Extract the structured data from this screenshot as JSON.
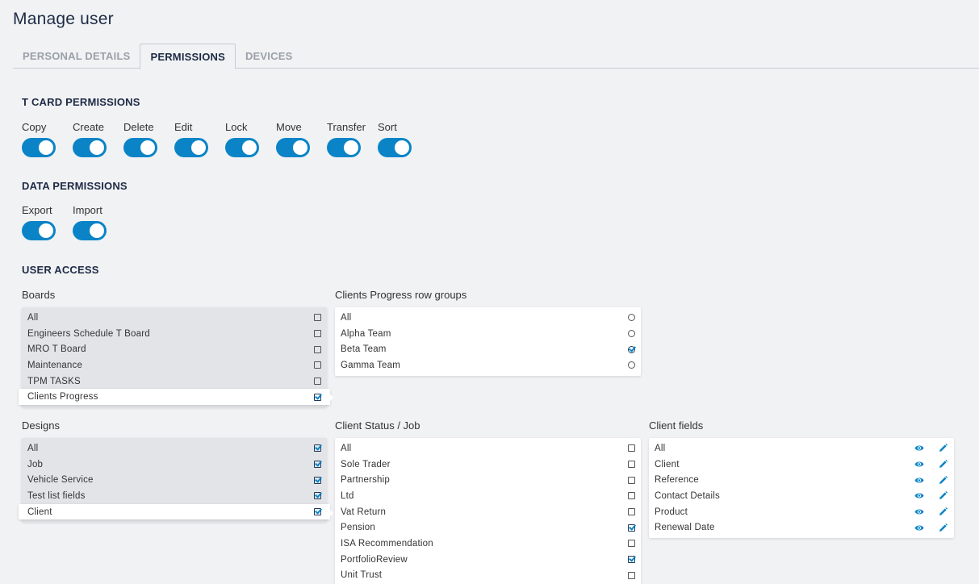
{
  "page": {
    "title": "Manage user"
  },
  "tabs": [
    {
      "label": "PERSONAL DETAILS",
      "active": false
    },
    {
      "label": "PERMISSIONS",
      "active": true
    },
    {
      "label": "DEVICES",
      "active": false
    }
  ],
  "t_card_permissions": {
    "title": "T CARD PERMISSIONS",
    "toggles": [
      {
        "label": "Copy",
        "on": true
      },
      {
        "label": "Create",
        "on": true
      },
      {
        "label": "Delete",
        "on": true
      },
      {
        "label": "Edit",
        "on": true
      },
      {
        "label": "Lock",
        "on": true
      },
      {
        "label": "Move",
        "on": true
      },
      {
        "label": "Transfer",
        "on": true
      },
      {
        "label": "Sort",
        "on": true
      }
    ]
  },
  "data_permissions": {
    "title": "DATA PERMISSIONS",
    "toggles": [
      {
        "label": "Export",
        "on": true
      },
      {
        "label": "Import",
        "on": true
      }
    ]
  },
  "user_access": {
    "title": "USER ACCESS",
    "boards": {
      "label": "Boards",
      "items": [
        {
          "label": "All",
          "checked": false
        },
        {
          "label": "Engineers Schedule T Board",
          "checked": false
        },
        {
          "label": "MRO T Board",
          "checked": false
        },
        {
          "label": "Maintenance",
          "checked": false
        },
        {
          "label": "TPM TASKS",
          "checked": false
        },
        {
          "label": "Clients Progress",
          "checked": true,
          "selected": true
        }
      ]
    },
    "row_groups": {
      "label": "Clients Progress row groups",
      "items": [
        {
          "label": "All",
          "checked": false
        },
        {
          "label": "Alpha Team",
          "checked": false
        },
        {
          "label": "Beta Team",
          "checked": true
        },
        {
          "label": "Gamma Team",
          "checked": false
        }
      ]
    },
    "designs": {
      "label": "Designs",
      "items": [
        {
          "label": "All",
          "checked": true
        },
        {
          "label": "Job",
          "checked": true
        },
        {
          "label": "Vehicle Service",
          "checked": true
        },
        {
          "label": "Test list fields",
          "checked": true
        },
        {
          "label": "Client",
          "checked": true,
          "selected": true
        }
      ]
    },
    "client_status": {
      "label": "Client Status / Job",
      "items": [
        {
          "label": "All",
          "checked": false
        },
        {
          "label": "Sole Trader",
          "checked": false
        },
        {
          "label": "Partnership",
          "checked": false
        },
        {
          "label": "Ltd",
          "checked": false
        },
        {
          "label": "Vat Return",
          "checked": false
        },
        {
          "label": "Pension",
          "checked": true
        },
        {
          "label": "ISA Recommendation",
          "checked": false
        },
        {
          "label": "PortfolioReview",
          "checked": true
        },
        {
          "label": "Unit Trust",
          "checked": false
        }
      ]
    },
    "client_fields": {
      "label": "Client fields",
      "items": [
        {
          "label": "All",
          "view": true,
          "edit": true
        },
        {
          "label": "Client",
          "view": true,
          "edit": true
        },
        {
          "label": "Reference",
          "view": true,
          "edit": true
        },
        {
          "label": "Contact Details",
          "view": true,
          "edit": true
        },
        {
          "label": "Product",
          "view": true,
          "edit": true
        },
        {
          "label": "Renewal Date",
          "view": true,
          "edit": true
        }
      ]
    }
  },
  "colors": {
    "accent": "#0a84c7",
    "heading": "#1e2b45",
    "background": "#f1f2f4"
  }
}
